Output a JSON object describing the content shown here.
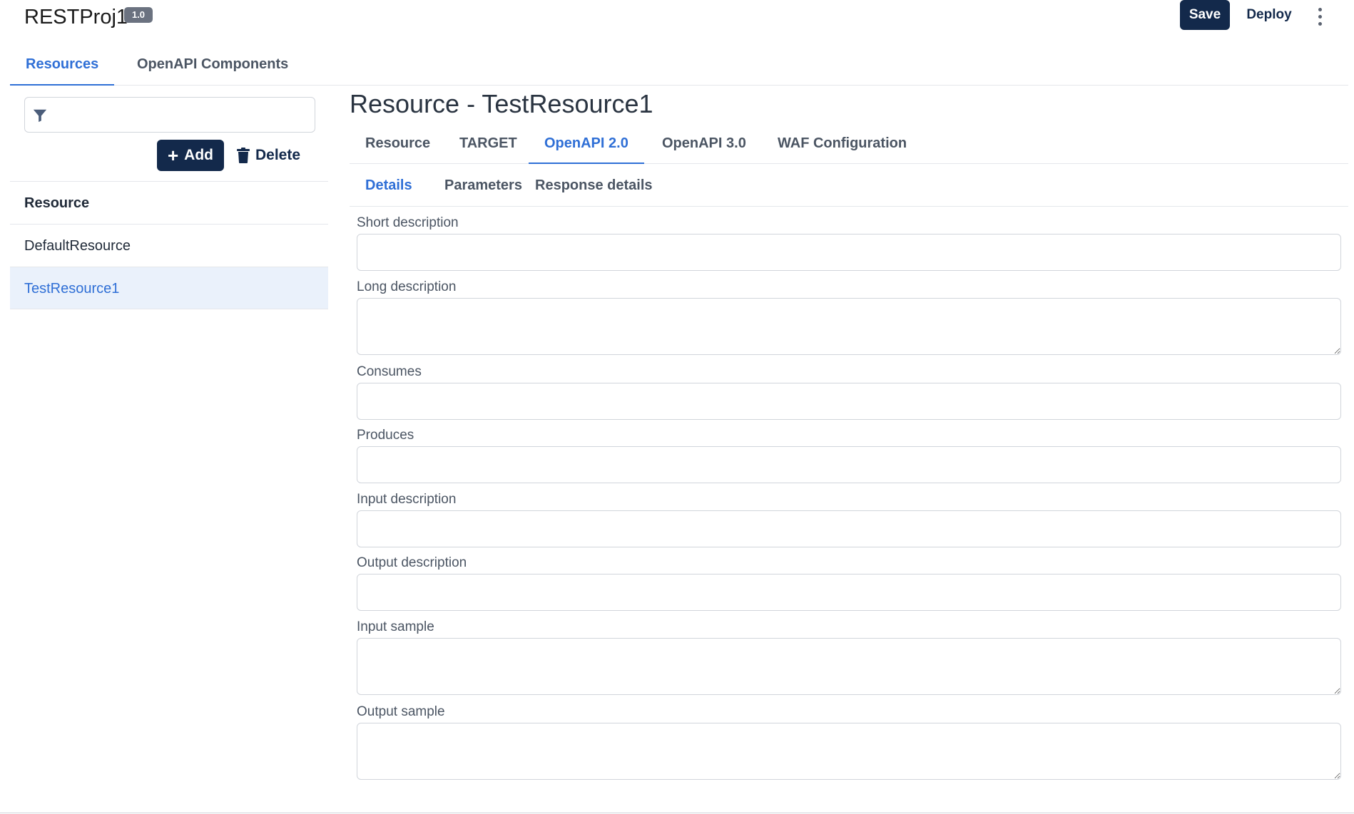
{
  "header": {
    "project_name": "RESTProj1",
    "version": "1.0",
    "save_label": "Save",
    "deploy_label": "Deploy",
    "more_icon": "kebab-menu-icon"
  },
  "top_tabs": [
    {
      "label": "Resources",
      "active": true
    },
    {
      "label": "OpenAPI Components",
      "active": false
    }
  ],
  "sidebar": {
    "filter_placeholder": "",
    "filter_icon": "filter-icon",
    "add_label": "Add",
    "delete_label": "Delete",
    "list_header": "Resource",
    "items": [
      {
        "label": "DefaultResource",
        "selected": false
      },
      {
        "label": "TestResource1",
        "selected": true
      }
    ]
  },
  "main": {
    "title": "Resource - TestResource1",
    "tabs": [
      {
        "label": "Resource",
        "active": false
      },
      {
        "label": "TARGET",
        "active": false
      },
      {
        "label": "OpenAPI 2.0",
        "active": true
      },
      {
        "label": "OpenAPI 3.0",
        "active": false
      },
      {
        "label": "WAF Configuration",
        "active": false
      }
    ],
    "subtabs": [
      {
        "label": "Details",
        "active": true
      },
      {
        "label": "Parameters",
        "active": false
      },
      {
        "label": "Response details",
        "active": false
      }
    ],
    "fields": [
      {
        "label": "Short description",
        "value": "",
        "type": "input"
      },
      {
        "label": "Long description",
        "value": "",
        "type": "textarea"
      },
      {
        "label": "Consumes",
        "value": "",
        "type": "input"
      },
      {
        "label": "Produces",
        "value": "",
        "type": "input"
      },
      {
        "label": "Input description",
        "value": "",
        "type": "input"
      },
      {
        "label": "Output description",
        "value": "",
        "type": "input"
      },
      {
        "label": "Input sample",
        "value": "",
        "type": "textarea"
      },
      {
        "label": "Output sample",
        "value": "",
        "type": "textarea"
      }
    ]
  },
  "colors": {
    "primary_dark": "#13294b",
    "accent": "#2f6fd6",
    "selected_bg": "#eaf1fb"
  }
}
